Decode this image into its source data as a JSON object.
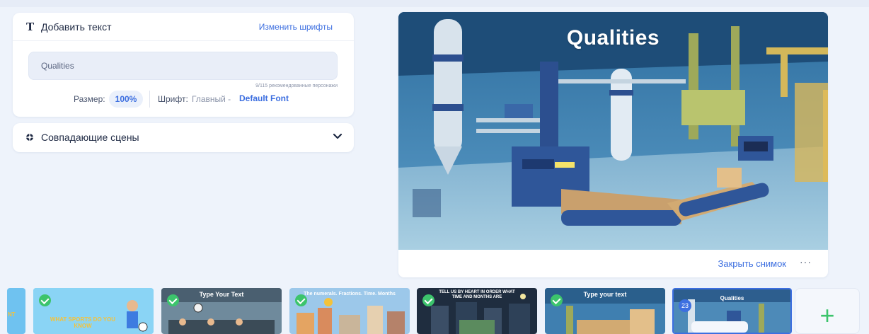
{
  "text_panel": {
    "title": "Добавить текст",
    "change_fonts": "Изменить шрифты",
    "input_value": "Qualities",
    "hint": "9/115 рекомендованные персонажи",
    "size_label": "Размер:",
    "size_value": "100%",
    "font_label": "Шрифт:",
    "font_main": "Главный -",
    "font_name": "Default Font"
  },
  "scenes_panel": {
    "title": "Совпадающие сцены"
  },
  "preview": {
    "title": "Qualities",
    "close_snapshot": "Закрыть снимок",
    "more": "···"
  },
  "filmstrip": {
    "partial_text": "NT",
    "thumbs": [
      {
        "caption": "WHAT SPORTS DO YOU KNOW"
      },
      {
        "caption": "Type Your Text"
      },
      {
        "caption": "The numerals. Fractions. Time. Months"
      },
      {
        "caption": "TELL US BY HEART IN ORDER WHAT TIME AND MONTHS ARE"
      },
      {
        "caption": "Type your text"
      },
      {
        "caption": "Qualities",
        "badge": "23"
      }
    ],
    "add_label": "+"
  },
  "colors": {
    "accent": "#3d6fe0",
    "success": "#3cc46c",
    "background": "#eef3fb"
  }
}
